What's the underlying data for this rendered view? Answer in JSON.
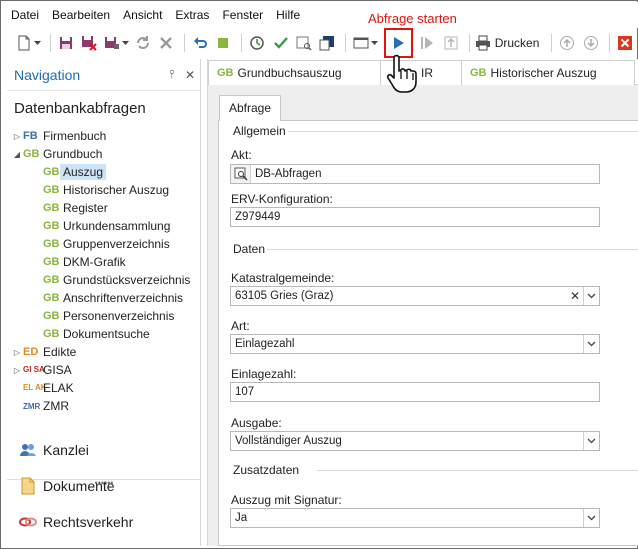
{
  "menu": [
    "Datei",
    "Bearbeiten",
    "Ansicht",
    "Extras",
    "Fenster",
    "Hilfe"
  ],
  "annotation": {
    "label": "Abfrage starten",
    "color": "#e0140e"
  },
  "toolbar": {
    "print_label": "Drucken",
    "icons": [
      "new-document-icon",
      "save-icon",
      "save-close-icon",
      "save-as-icon",
      "refresh-icon",
      "delete-icon",
      "undo-icon",
      "stop-icon",
      "history-icon",
      "check-icon",
      "preview-icon",
      "export-icon",
      "layout-icon",
      "play-icon",
      "step-icon",
      "upload-icon",
      "printer-icon",
      "arrow-up-icon",
      "arrow-down-icon",
      "close-window-icon"
    ]
  },
  "nav": {
    "title": "Navigation",
    "section": "Datenbankabfragen",
    "tree": [
      {
        "abbr": "FB",
        "label": "Firmenbuch",
        "level": 0,
        "state": "collapsed",
        "kind": "fb"
      },
      {
        "abbr": "GB",
        "label": "Grundbuch",
        "level": 0,
        "state": "expanded",
        "kind": "gb"
      },
      {
        "abbr": "GB",
        "label": "Auszug",
        "level": 1,
        "state": "selected",
        "kind": "gb"
      },
      {
        "abbr": "GB",
        "label": "Historischer Auszug",
        "level": 1,
        "state": "",
        "kind": "gb"
      },
      {
        "abbr": "GB",
        "label": "Register",
        "level": 1,
        "state": "",
        "kind": "gb"
      },
      {
        "abbr": "GB",
        "label": "Urkundensammlung",
        "level": 1,
        "state": "",
        "kind": "gb"
      },
      {
        "abbr": "GB",
        "label": "Gruppenverzeichnis",
        "level": 1,
        "state": "",
        "kind": "gb"
      },
      {
        "abbr": "GB",
        "label": "DKM-Grafik",
        "level": 1,
        "state": "",
        "kind": "gb"
      },
      {
        "abbr": "GB",
        "label": "Grundstücksverzeichnis",
        "level": 1,
        "state": "",
        "kind": "gb"
      },
      {
        "abbr": "GB",
        "label": "Anschriftenverzeichnis",
        "level": 1,
        "state": "",
        "kind": "gb"
      },
      {
        "abbr": "GB",
        "label": "Personenverzeichnis",
        "level": 1,
        "state": "",
        "kind": "gb"
      },
      {
        "abbr": "GB",
        "label": "Dokumentsuche",
        "level": 1,
        "state": "",
        "kind": "gb"
      },
      {
        "abbr": "ED",
        "label": "Edikte",
        "level": 0,
        "state": "collapsed",
        "kind": "ed"
      },
      {
        "abbr": "GI SA",
        "label": "GISA",
        "level": 0,
        "state": "collapsed",
        "kind": "gisa"
      },
      {
        "abbr": "EL AK",
        "label": "ELAK",
        "level": 0,
        "state": "",
        "kind": "elak"
      },
      {
        "abbr": "ZMR",
        "label": "ZMR",
        "level": 0,
        "state": "",
        "kind": "zmr"
      }
    ],
    "bottom": [
      {
        "label": "Kanzlei",
        "icon": "people-icon"
      },
      {
        "label": "Dokumente",
        "icon": "document-icon"
      },
      {
        "label": "Rechtsverkehr",
        "icon": "link-icon"
      }
    ]
  },
  "doctabs": [
    {
      "prefix": "GB",
      "label": "Grundbuchsauszug"
    },
    {
      "prefix": "",
      "label": "IR"
    },
    {
      "prefix": "GB",
      "label": "Historischer Auszug"
    }
  ],
  "form": {
    "tab": "Abfrage",
    "groups": {
      "allgemein": "Allgemein",
      "daten": "Daten",
      "zusatz": "Zusatzdaten"
    },
    "akt": {
      "label": "Akt:",
      "value": "DB-Abfragen"
    },
    "erv": {
      "label": "ERV-Konfiguration:",
      "value": "Z979449"
    },
    "kg": {
      "label": "Katastralgemeinde:",
      "value": "63105 Gries (Graz)"
    },
    "art": {
      "label": "Art:",
      "value": "Einlagezahl"
    },
    "ez": {
      "label": "Einlagezahl:",
      "value": "107"
    },
    "ausgabe": {
      "label": "Ausgabe:",
      "value": "Vollständiger Auszug"
    },
    "signatur": {
      "label": "Auszug mit Signatur:",
      "value": "Ja"
    }
  }
}
